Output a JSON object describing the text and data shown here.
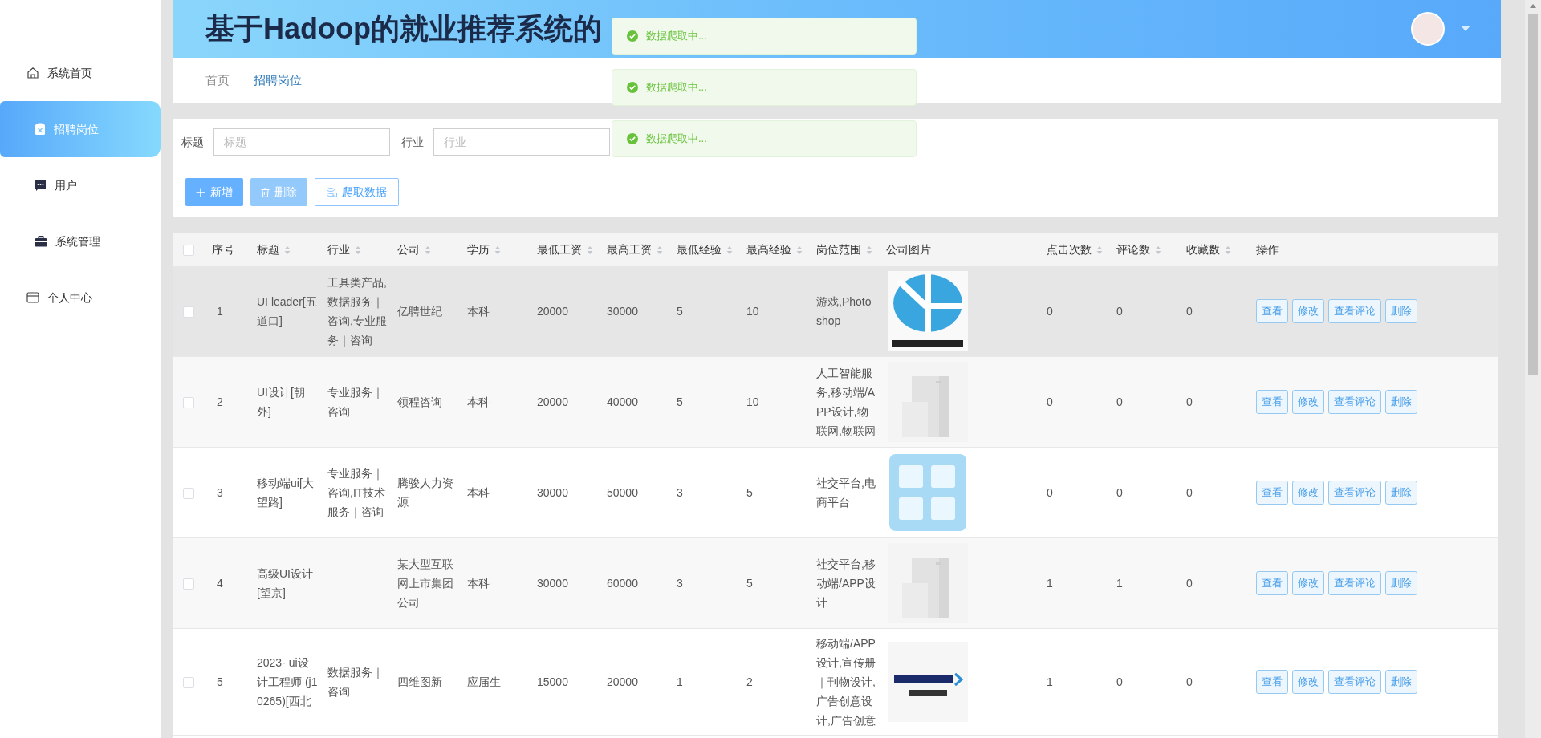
{
  "header": {
    "title": "基于Hadoop的就业推荐系统的"
  },
  "toasts": [
    {
      "text": "数据爬取中..."
    },
    {
      "text": "数据爬取中..."
    },
    {
      "text": "数据爬取中..."
    }
  ],
  "sidebar": {
    "items": [
      {
        "label": "系统首页",
        "selected": false
      },
      {
        "label": "招聘岗位",
        "selected": true
      },
      {
        "label": "用户",
        "selected": false
      },
      {
        "label": "系统管理",
        "selected": false
      },
      {
        "label": "个人中心",
        "selected": false
      }
    ]
  },
  "breadcrumb": [
    {
      "label": "首页",
      "current": false
    },
    {
      "label": "招聘岗位",
      "current": true
    }
  ],
  "search": {
    "fields": [
      {
        "label": "标题",
        "placeholder": "标题"
      },
      {
        "label": "行业",
        "placeholder": "行业"
      }
    ],
    "buttons": [
      {
        "label": "新增",
        "kind": "add",
        "disabled": false
      },
      {
        "label": "删除",
        "kind": "delete",
        "disabled": true
      },
      {
        "label": "爬取数据",
        "kind": "crawl",
        "disabled": false
      }
    ]
  },
  "table": {
    "all_checked": false,
    "columns": [
      {
        "label": "序号",
        "sortable": false
      },
      {
        "label": "标题",
        "sortable": true
      },
      {
        "label": "行业",
        "sortable": true
      },
      {
        "label": "公司",
        "sortable": true
      },
      {
        "label": "学历",
        "sortable": true
      },
      {
        "label": "最低工资",
        "sortable": true
      },
      {
        "label": "最高工资",
        "sortable": true
      },
      {
        "label": "最低经验",
        "sortable": true
      },
      {
        "label": "最高经验",
        "sortable": true
      },
      {
        "label": "岗位范围",
        "sortable": true
      },
      {
        "label": "公司图片",
        "sortable": false
      },
      {
        "label": "点击次数",
        "sortable": true
      },
      {
        "label": "评论数",
        "sortable": true
      },
      {
        "label": "收藏数",
        "sortable": true
      },
      {
        "label": "操作",
        "sortable": false
      }
    ],
    "rows": [
      {
        "checked": false,
        "highlighted": true,
        "no": "1",
        "title": "UI leader[五道口]",
        "industry": "工具类产品,数据服务｜咨询,专业服务｜咨询",
        "company": "亿聘世纪",
        "education": "本科",
        "min_salary": "20000",
        "max_salary": "30000",
        "min_exp": "5",
        "max_exp": "10",
        "scope": "游戏,Photoshop",
        "clicks": "0",
        "comments": "0",
        "favorites": "0",
        "actions": [
          "查看",
          "修改",
          "查看评论",
          "删除"
        ]
      },
      {
        "checked": false,
        "highlighted": false,
        "no": "2",
        "title": "UI设计[朝外]",
        "industry": "专业服务｜咨询",
        "company": "领程咨询",
        "education": "本科",
        "min_salary": "20000",
        "max_salary": "40000",
        "min_exp": "5",
        "max_exp": "10",
        "scope": "人工智能服务,移动端/APP设计,物联网,物联网",
        "clicks": "0",
        "comments": "0",
        "favorites": "0",
        "actions": [
          "查看",
          "修改",
          "查看评论",
          "删除"
        ]
      },
      {
        "checked": false,
        "highlighted": false,
        "no": "3",
        "title": "移动端ui[大望路]",
        "industry": "专业服务｜咨询,IT技术服务｜咨询",
        "company": "腾骏人力资源",
        "education": "本科",
        "min_salary": "30000",
        "max_salary": "50000",
        "min_exp": "3",
        "max_exp": "5",
        "scope": "社交平台,电商平台",
        "clicks": "0",
        "comments": "0",
        "favorites": "0",
        "actions": [
          "查看",
          "修改",
          "查看评论",
          "删除"
        ]
      },
      {
        "checked": false,
        "highlighted": false,
        "no": "4",
        "title": "高级UI设计[望京]",
        "company": "某大型互联网上市集团公司",
        "education": "本科",
        "min_salary": "30000",
        "max_salary": "60000",
        "min_exp": "3",
        "max_exp": "5",
        "scope": "社交平台,移动端/APP设计",
        "clicks": "1",
        "comments": "1",
        "favorites": "0",
        "actions": [
          "查看",
          "修改",
          "查看评论",
          "删除"
        ]
      },
      {
        "checked": false,
        "highlighted": false,
        "no": "5",
        "title": "2023- ui设计工程师 (j10265)[西北",
        "industry": "数据服务｜咨询",
        "company": "四维图新",
        "education": "应届生",
        "min_salary": "15000",
        "max_salary": "20000",
        "min_exp": "1",
        "max_exp": "2",
        "scope": "移动端/APP设计,宣传册｜刊物设计,广告创意设计,广告创意",
        "clicks": "1",
        "comments": "0",
        "favorites": "0",
        "actions": [
          "查看",
          "修改",
          "查看评论",
          "删除"
        ]
      }
    ]
  }
}
